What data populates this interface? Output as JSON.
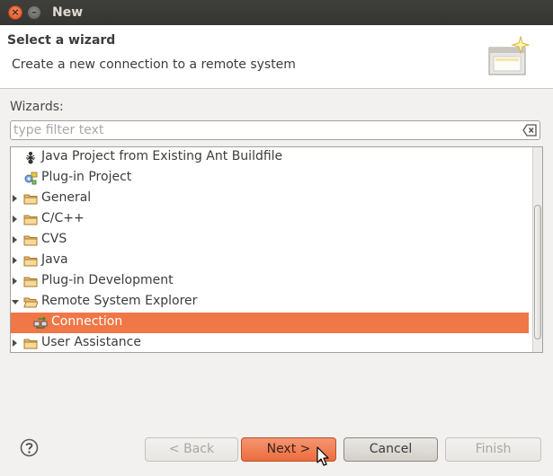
{
  "window": {
    "title": "New"
  },
  "header": {
    "title": "Select a wizard",
    "description": "Create a new connection to a remote system"
  },
  "wizards": {
    "label": "Wizards:",
    "filter_placeholder": "type filter text",
    "filter_value": "",
    "items": [
      {
        "label": "Java Project from Existing Ant Buildfile",
        "icon": "ant-icon",
        "expander": "none",
        "selected": false
      },
      {
        "label": "Plug-in Project",
        "icon": "plugin-project-icon",
        "expander": "none",
        "selected": false
      },
      {
        "label": "General",
        "icon": "folder-icon",
        "expander": "collapsed",
        "selected": false
      },
      {
        "label": "C/C++",
        "icon": "folder-icon",
        "expander": "collapsed",
        "selected": false
      },
      {
        "label": "CVS",
        "icon": "folder-icon",
        "expander": "collapsed",
        "selected": false
      },
      {
        "label": "Java",
        "icon": "folder-icon",
        "expander": "collapsed",
        "selected": false
      },
      {
        "label": "Plug-in Development",
        "icon": "folder-icon",
        "expander": "collapsed",
        "selected": false
      },
      {
        "label": "Remote System Explorer",
        "icon": "folder-open-icon",
        "expander": "expanded",
        "selected": false
      },
      {
        "label": "Connection",
        "icon": "connection-icon",
        "expander": "none",
        "selected": true
      },
      {
        "label": "User Assistance",
        "icon": "folder-icon",
        "expander": "collapsed",
        "selected": false
      }
    ]
  },
  "buttons": {
    "back": "< Back",
    "next": "Next >",
    "cancel": "Cancel",
    "finish": "Finish"
  },
  "colors": {
    "selection": "#f07746",
    "primary_button": "#ec6d3d",
    "title_bar": "#3c3c39"
  }
}
